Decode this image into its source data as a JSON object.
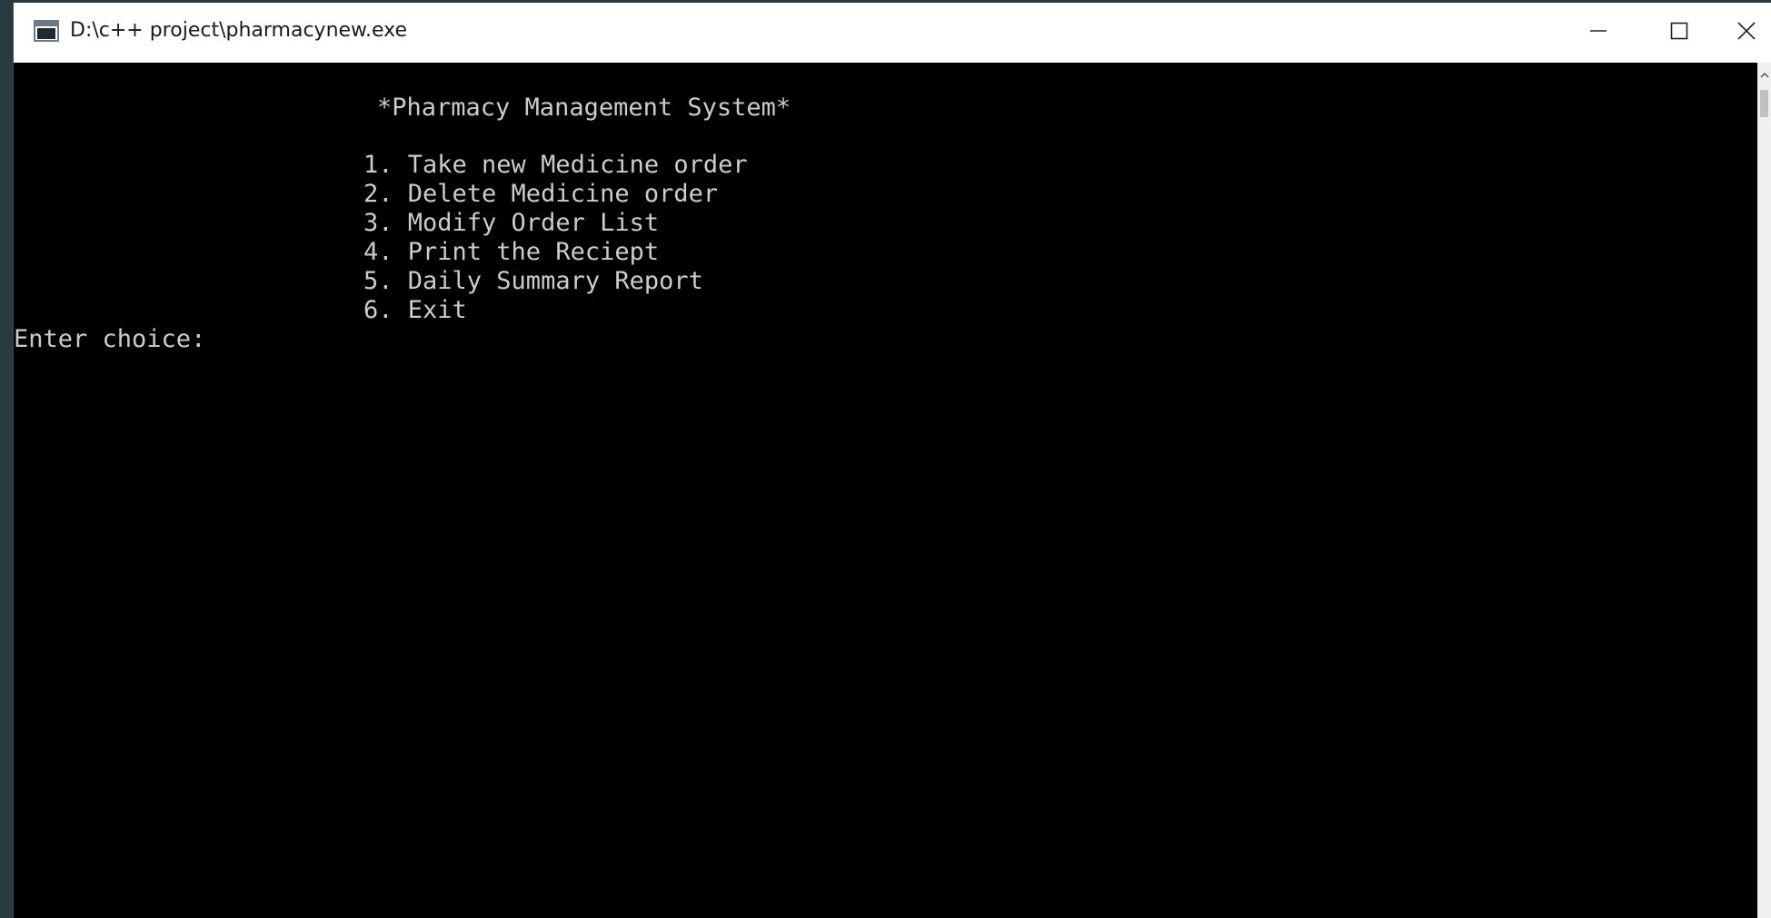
{
  "window": {
    "title": "D:\\c++ project\\pharmacynew.exe",
    "app_icon": "console-app-icon",
    "controls": {
      "minimize": "minimize-icon",
      "maximize": "maximize-icon",
      "close": "close-icon"
    }
  },
  "console": {
    "heading": "*Pharmacy Management System*",
    "menu_items": [
      "1. Take new Medicine order",
      "2. Delete Medicine order",
      "3. Modify Order List",
      "4. Print the Reciept",
      "5. Daily Summary Report",
      "6. Exit"
    ],
    "prompt": "Enter choice:",
    "text_color": "#cccccc",
    "background_color": "#000000"
  }
}
